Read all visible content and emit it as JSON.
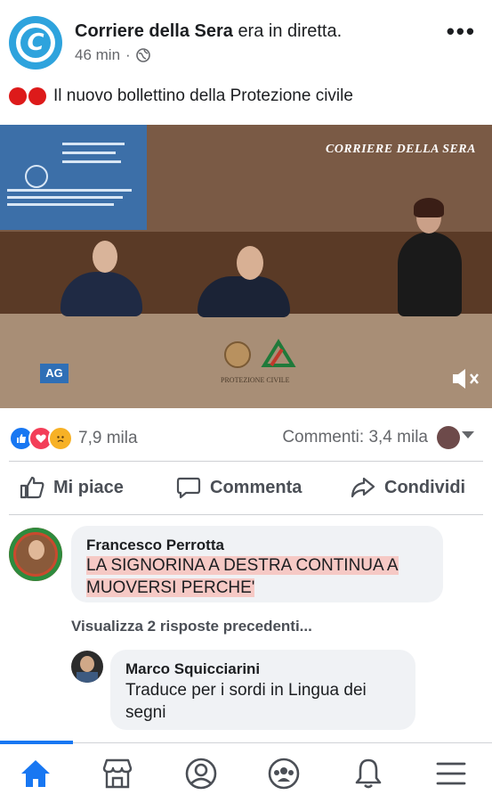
{
  "post": {
    "page_name": "Corriere della Sera",
    "page_action": "era in diretta.",
    "time": "46 min",
    "audience_icon": "globe-icon",
    "text": "Il nuovo bollettino della Protezione civile",
    "lead_emoji": "red-circle-icon"
  },
  "video": {
    "watermark": "CORRIERE DELLA SERA",
    "channel_badge": "AG",
    "emblem_caption": "PROTEZIONE CIVILE",
    "mute_icon": "speaker-muted-icon"
  },
  "stats": {
    "reactions": [
      "like-icon",
      "love-icon",
      "sad-icon"
    ],
    "reaction_count": "7,9 mila",
    "comments_count": "Commenti: 3,4 mila"
  },
  "actions": {
    "like": "Mi piace",
    "comment": "Commenta",
    "share": "Condividi"
  },
  "comments": [
    {
      "author": "Francesco Perrotta",
      "text": "LA SIGNORINA A DESTRA CONTINUA A MUOVERSI PERCHE'"
    },
    {
      "author": "Marco Squicciarini",
      "text": "Traduce per i sordi in Lingua dei segni"
    }
  ],
  "view_replies": "Visualizza 2 risposte precedenti...",
  "nav": [
    "home-icon",
    "marketplace-icon",
    "profile-icon",
    "groups-icon",
    "notifications-icon",
    "menu-icon"
  ],
  "colors": {
    "brand": "#1877f2",
    "logo": "#2ea3dd",
    "highlight": "#f6c9c5"
  }
}
